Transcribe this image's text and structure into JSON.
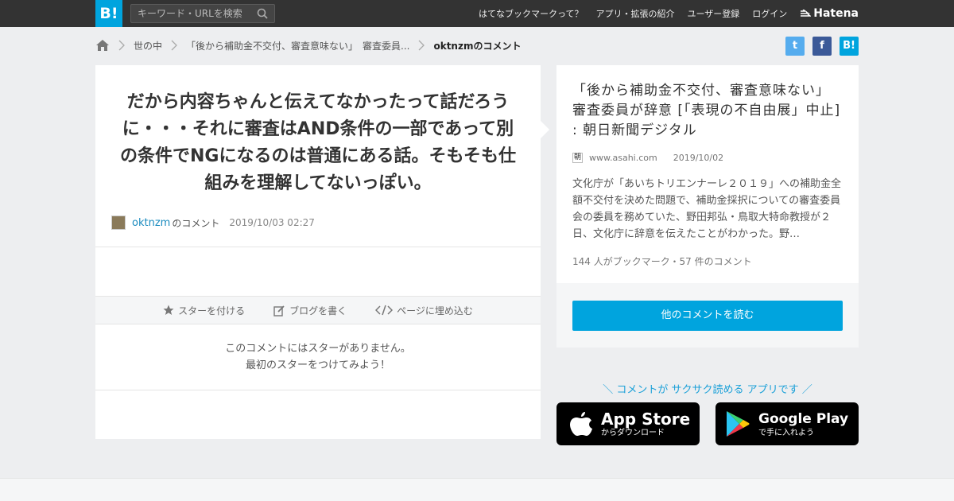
{
  "header": {
    "logo_text": "B!",
    "search_placeholder": "キーワード・URLを検索",
    "nav": [
      "はてなブックマークって？",
      "アプリ・拡張の紹介",
      "ユーザー登録",
      "ログイン"
    ],
    "brand": "Hatena"
  },
  "breadcrumb": {
    "items": [
      "世の中",
      "「後から補助金不交付、審査意味ない」　審査委員..."
    ],
    "current": "oktnzmのコメント"
  },
  "share": {
    "twitter": "t",
    "facebook": "f",
    "hatebu": "B!"
  },
  "comment": {
    "text": "だから内容ちゃんと伝えてなかったって話だろうに・・・それに審査はAND条件の一部であって別の条件でNGになるのは普通にある話。そもそも仕組みを理解してないっぽい。",
    "user": "oktnzm",
    "user_suffix": "のコメント",
    "date": "2019/10/03 02:27",
    "actions": {
      "star": "スターを付ける",
      "blog": "ブログを書く",
      "embed": "ページに埋め込む"
    },
    "no_star_line1": "このコメントにはスターがありません。",
    "no_star_line2": "最初のスターをつけてみよう！"
  },
  "article": {
    "title": "「後から補助金不交付、審査意味ない」　審査委員が辞意 [「表現の不自由展」中止] : 朝日新聞デジタル",
    "favicon": "朝",
    "domain": "www.asahi.com",
    "date": "2019/10/02",
    "description": "文化庁が「あいちトリエンナーレ２０１９」への補助金全額不交付を決めた問題で、補助金採択についての審査委員会の委員を務めていた、野田邦弘・鳥取大特命教授が２日、文化庁に辞意を伝えたことがわかった。野…",
    "count": "144 人がブックマーク・57 件のコメント",
    "read_more": "他のコメントを読む"
  },
  "promo": {
    "text": "＼ コメントが サクサク読める アプリです ／",
    "apple_big": "App Store",
    "apple_small": "からダウンロード",
    "google_big": "Google Play",
    "google_small": "で手に入れよう"
  },
  "colors": {
    "accent": "#00a4de",
    "header_bg": "#333333",
    "twitter": "#55acee",
    "facebook": "#3b5998"
  }
}
